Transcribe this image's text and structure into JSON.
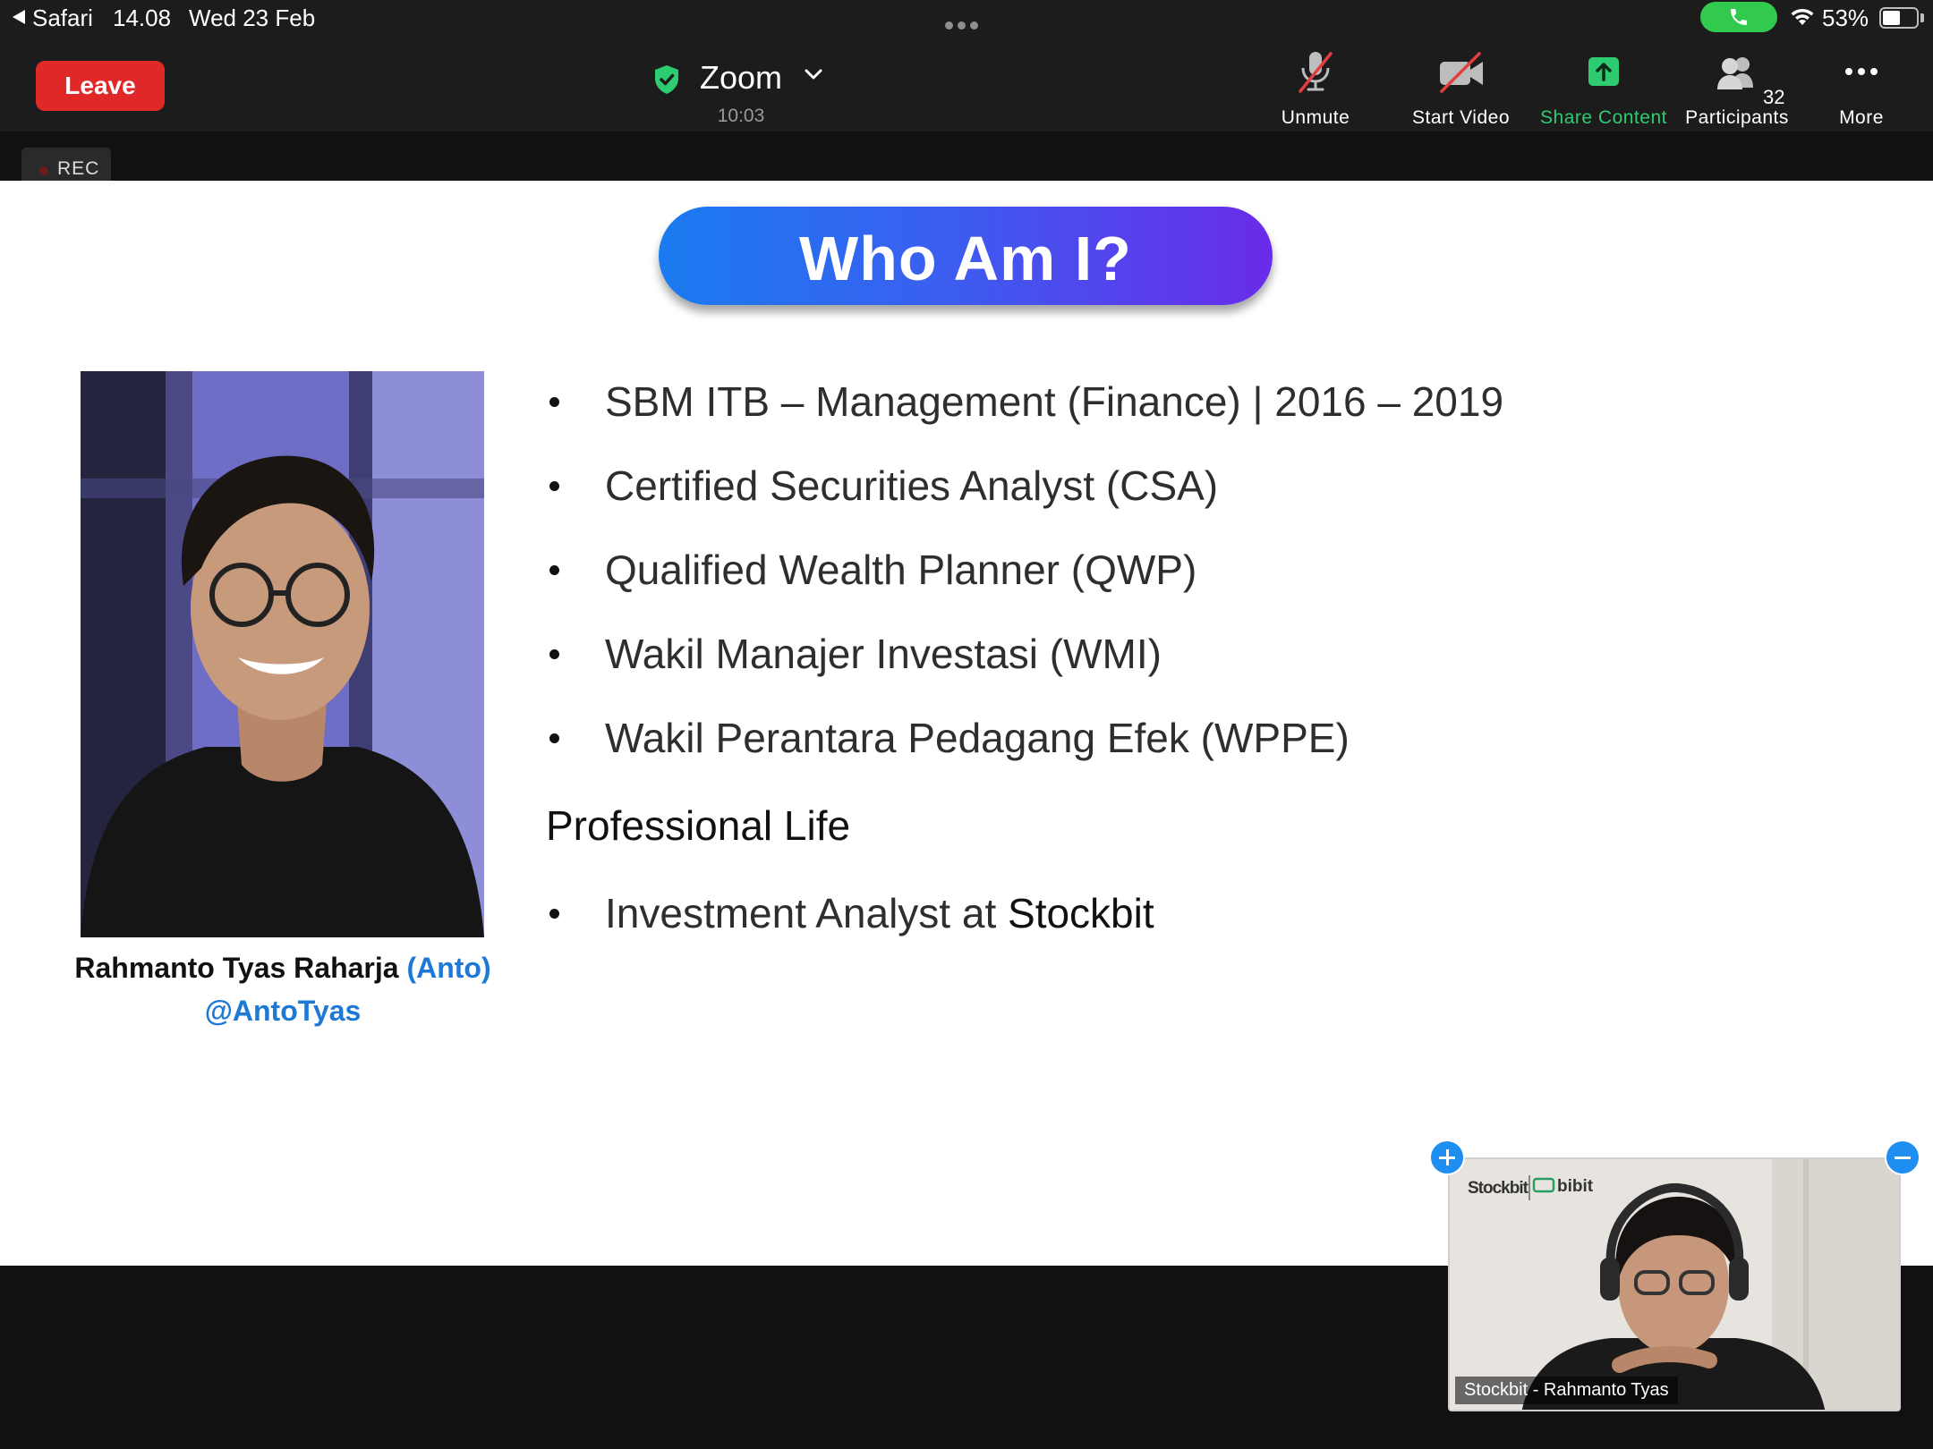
{
  "status_bar": {
    "back_app": "Safari",
    "time": "14.08",
    "date": "Wed 23 Feb",
    "battery": "53%",
    "battery_level": 0.53
  },
  "toolbar": {
    "leave_label": "Leave",
    "meeting_title": "Zoom",
    "meeting_timer": "10:03",
    "unmute_label": "Unmute",
    "start_video_label": "Start Video",
    "share_content_label": "Share Content",
    "participants_label": "Participants",
    "participants_count": "32",
    "more_label": "More"
  },
  "rec": {
    "label": "REC"
  },
  "slide": {
    "title": "Who Am I?",
    "presenter_name": "Rahmanto Tyas Raharja",
    "presenter_nickname": "(Anto)",
    "presenter_handle": "@AntoTyas",
    "education_items": [
      "SBM ITB – Management (Finance) | 2016 – 2019",
      "Certified Securities Analyst (CSA)",
      "Qualified Wealth Planner (QWP)",
      "Wakil Manajer Investasi (WMI)",
      "Wakil Perantara Pedagang Efek (WPPE)"
    ],
    "section_heading": "Professional Life",
    "job_prefix": "Investment Analyst at ",
    "employer": "Stockbit"
  },
  "self_view": {
    "name": "Stockbit - Rahmanto Tyas",
    "logo_stockbit": "Stockbit",
    "logo_bibit": "bibit"
  },
  "colors": {
    "leave": "#e02828",
    "share_content": "#2ecc71",
    "title_gradient_start": "#1a7bf0",
    "title_gradient_end": "#6a2bea",
    "handle_blue": "#1e78d6",
    "pip_button": "#1e8ff0"
  },
  "icons": {
    "unmute": "microphone-muted-icon",
    "start_video": "video-camera-off-icon",
    "share_content": "share-arrow-up-icon",
    "participants": "people-icon",
    "more": "more-dots-icon"
  }
}
